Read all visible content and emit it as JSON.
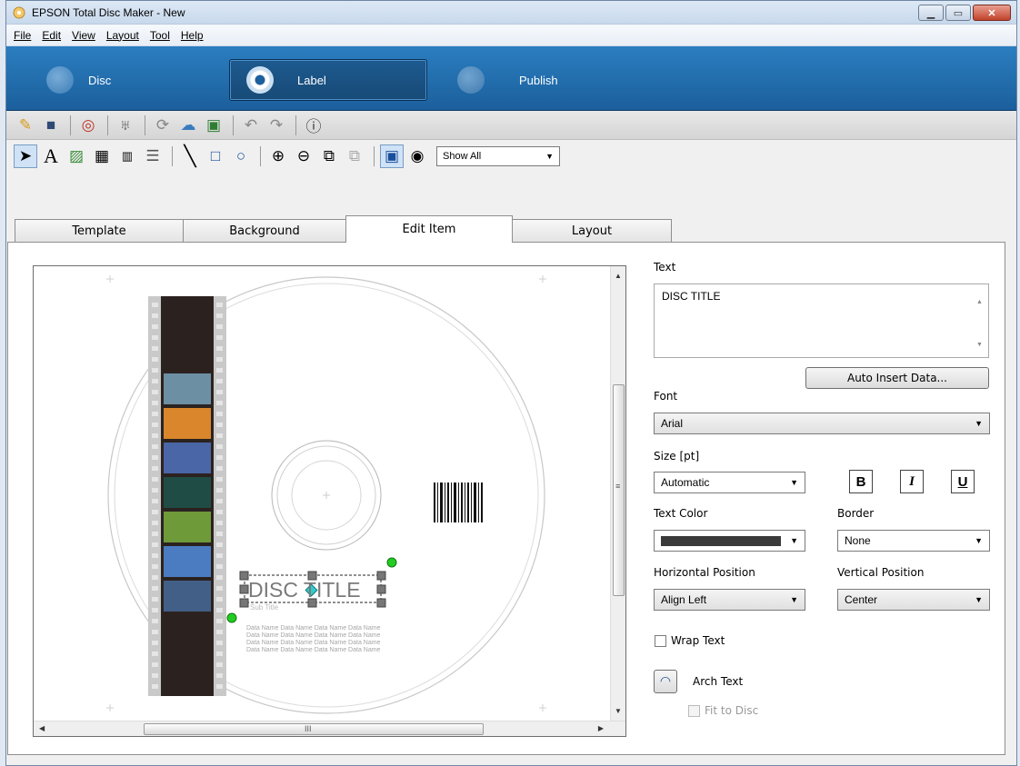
{
  "window": {
    "title": "EPSON Total Disc Maker - New"
  },
  "menu": [
    "File",
    "Edit",
    "View",
    "Layout",
    "Tool",
    "Help"
  ],
  "modes": [
    {
      "label": "Disc",
      "selected": false
    },
    {
      "label": "Label",
      "selected": true
    },
    {
      "label": "Publish",
      "selected": false
    }
  ],
  "toolbar2": {
    "show_dropdown": "Show All"
  },
  "tabs": [
    "Template",
    "Background",
    "Edit Item",
    "Layout"
  ],
  "active_tab": "Edit Item",
  "canvas": {
    "disc_title": "DISC TITLE",
    "subtitle": "Sub Title",
    "data_lines": [
      "Data Name Data Name Data Name Data Name",
      "Data Name Data Name Data Name Data Name",
      "Data Name Data Name Data Name Data Name",
      "Data Name Data Name Data Name Data Name"
    ],
    "hscroll_grip": "III"
  },
  "edit_item": {
    "text_label": "Text",
    "text_value": "DISC TITLE",
    "auto_insert_button": "Auto Insert Data...",
    "font_label": "Font",
    "font_value": "Arial",
    "size_label": "Size [pt]",
    "size_value": "Automatic",
    "bold_label": "B",
    "italic_label": "I",
    "underline_label": "U",
    "text_color_label": "Text Color",
    "text_color": "#3a3a3a",
    "border_label": "Border",
    "border_value": "None",
    "hpos_label": "Horizontal Position",
    "hpos_value": "Align Left",
    "vpos_label": "Vertical Position",
    "vpos_value": "Center",
    "wrap_text_label": "Wrap Text",
    "arch_text_label": "Arch Text",
    "fit_to_disc_label": "Fit to Disc"
  },
  "colors": {
    "accent": "#1b5f9c",
    "selection_handle": "#777777",
    "rotate_handle": "#22cc22",
    "center_handle": "#33cccc"
  }
}
